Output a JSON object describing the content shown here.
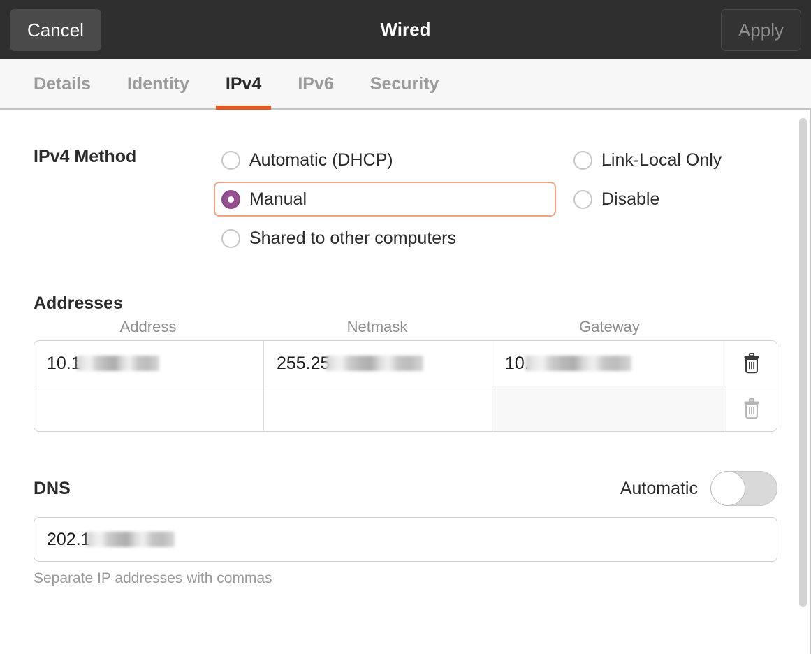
{
  "window": {
    "title": "Wired",
    "cancel_label": "Cancel",
    "apply_label": "Apply",
    "accent_color": "#e8561f",
    "radio_selected_color": "#94508f",
    "focus_ring_color": "#f2a183",
    "headerbar_bg": "#2f2f2f"
  },
  "tabs": [
    {
      "label": "Details",
      "active": false
    },
    {
      "label": "Identity",
      "active": false
    },
    {
      "label": "IPv4",
      "active": true
    },
    {
      "label": "IPv6",
      "active": false
    },
    {
      "label": "Security",
      "active": false
    }
  ],
  "ipv4_method": {
    "label": "IPv4 Method",
    "options_left": [
      {
        "label": "Automatic (DHCP)",
        "selected": false,
        "focused": false
      },
      {
        "label": "Manual",
        "selected": true,
        "focused": true
      },
      {
        "label": "Shared to other computers",
        "selected": false,
        "focused": false
      }
    ],
    "options_right": [
      {
        "label": "Link-Local Only",
        "selected": false,
        "focused": false
      },
      {
        "label": "Disable",
        "selected": false,
        "focused": false
      }
    ]
  },
  "addresses": {
    "title": "Addresses",
    "columns": [
      "Address",
      "Netmask",
      "Gateway"
    ],
    "rows": [
      {
        "address": "10.1",
        "address_redacted": true,
        "netmask": "255.25",
        "netmask_redacted": true,
        "gateway": "10.",
        "gateway_redacted": true,
        "delete_icon": "trash-icon",
        "delete_enabled": true,
        "gateway_disabled": false
      },
      {
        "address": "",
        "address_redacted": false,
        "netmask": "",
        "netmask_redacted": false,
        "gateway": "",
        "gateway_redacted": false,
        "delete_icon": "trash-icon",
        "delete_enabled": false,
        "gateway_disabled": true
      }
    ]
  },
  "dns": {
    "title": "DNS",
    "automatic_label": "Automatic",
    "automatic_on": false,
    "value": "202.1",
    "value_redacted": true,
    "hint": "Separate IP addresses with commas"
  }
}
